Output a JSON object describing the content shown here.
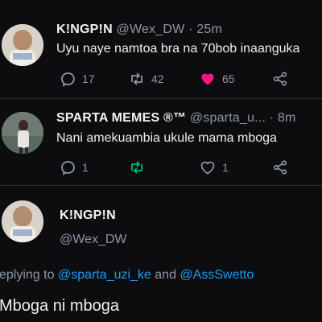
{
  "tweets": [
    {
      "name": "K!NGP!N",
      "handle": "@Wex_DW",
      "separator": "·",
      "time": "25m",
      "text": "Uyu naye namtoa bra na 70bob inaanguka",
      "replies": "17",
      "retweets": "42",
      "likes": "65",
      "liked": true
    },
    {
      "name": "SPARTA MEMES ®™",
      "handle": "@sparta_u...",
      "separator": "·",
      "time": "8m",
      "text": "Nani amekuambia ukule mama mboga",
      "replies": "1",
      "retweets": "",
      "likes": "1",
      "liked": false
    }
  ],
  "main_tweet": {
    "name": "K!NGP!N",
    "handle": "@Wex_DW",
    "replying_prefix": "eplying to",
    "replying_user1": "@sparta_uzi_ke",
    "replying_and": "and",
    "replying_user2": "@AssSwetto",
    "text": "Mboga ni mboga"
  },
  "colors": {
    "background": "#0d0d0f",
    "link": "#1d9bf0",
    "like": "#f91880",
    "retweet_active": "#00ba7c",
    "muted": "#8b98a5"
  }
}
